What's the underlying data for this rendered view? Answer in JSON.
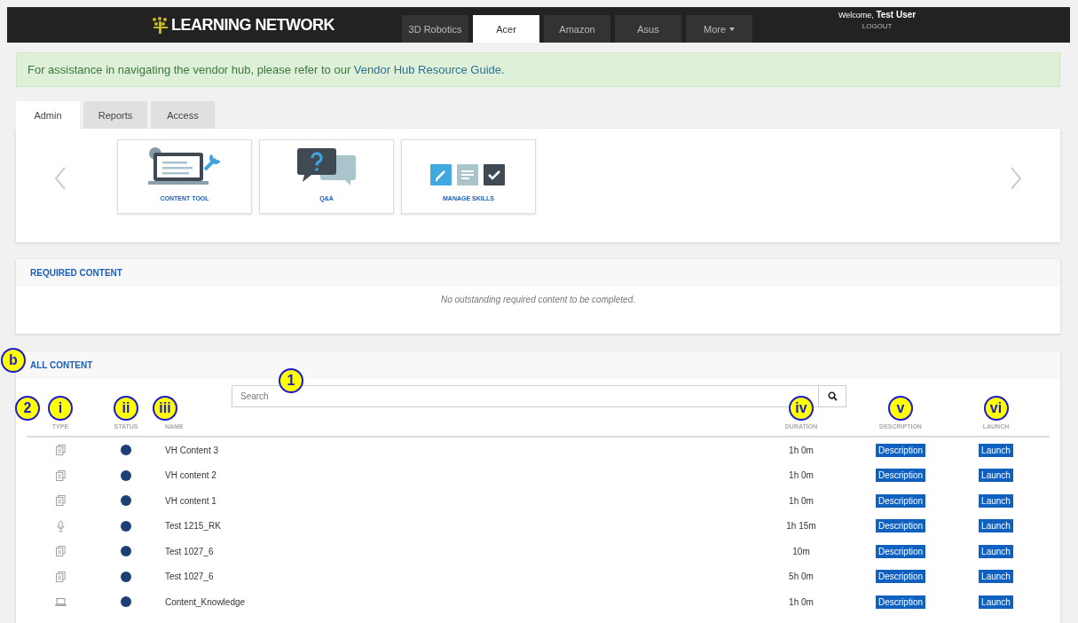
{
  "nav": {
    "brand": "LEARNING NETWORK",
    "tabs": [
      {
        "label": "3D Robotics",
        "selected": false,
        "dropdown": false
      },
      {
        "label": "Acer",
        "selected": true,
        "dropdown": false
      },
      {
        "label": "Amazon",
        "selected": false,
        "dropdown": false
      },
      {
        "label": "Asus",
        "selected": false,
        "dropdown": false
      },
      {
        "label": "More",
        "selected": false,
        "dropdown": true
      }
    ],
    "welcome": "Welcome,",
    "user": "Test User",
    "logout": "LOGOUT"
  },
  "alert": {
    "text": "For assistance in navigating the vendor hub, please refer to our",
    "link": "Vendor Hub Resource Guide."
  },
  "tabs": [
    {
      "label": "Admin",
      "selected": true
    },
    {
      "label": "Reports",
      "selected": false
    },
    {
      "label": "Access",
      "selected": false
    }
  ],
  "tools": [
    {
      "kind": "content",
      "label": "CONTENT TOOL"
    },
    {
      "kind": "qa",
      "label": "Q&A"
    },
    {
      "kind": "skills",
      "label": "MANAGE SKILLS"
    }
  ],
  "required": {
    "title": "REQUIRED CONTENT",
    "empty": "No outstanding required content to be completed."
  },
  "all_content": {
    "title": "ALL CONTENT",
    "callout": "b",
    "search": {
      "placeholder": "Search",
      "callout": "1"
    },
    "header_callout": "2",
    "columns": [
      {
        "label": "TYPE",
        "callout": "i"
      },
      {
        "label": "STATUS",
        "callout": "ii"
      },
      {
        "label": "NAME",
        "callout": "iii"
      },
      {
        "label": "DURATION",
        "callout": "iv"
      },
      {
        "label": "DESCRIPTION",
        "callout": "v"
      },
      {
        "label": "LAUNCH",
        "callout": "vi"
      }
    ],
    "rows": [
      {
        "kind": "document",
        "name": "VH Content 3",
        "duration": "1h 0m",
        "description": "Description",
        "launch": "Launch"
      },
      {
        "kind": "document",
        "name": "VH content 2",
        "duration": "1h 0m",
        "description": "Description",
        "launch": "Launch"
      },
      {
        "kind": "document",
        "name": "VH content 1",
        "duration": "1h 0m",
        "description": "Description",
        "launch": "Launch"
      },
      {
        "kind": "audio",
        "name": "Test 1215_RK",
        "duration": "1h 15m",
        "description": "Description",
        "launch": "Launch"
      },
      {
        "kind": "document",
        "name": "Test 1027_6",
        "duration": "10m",
        "description": "Description",
        "launch": "Launch"
      },
      {
        "kind": "document",
        "name": "Test 1027_6",
        "duration": "5h 0m",
        "description": "Description",
        "launch": "Launch"
      },
      {
        "kind": "laptop",
        "name": "Content_Knowledge",
        "duration": "1h 0m",
        "description": "Description",
        "launch": "Launch"
      }
    ]
  }
}
